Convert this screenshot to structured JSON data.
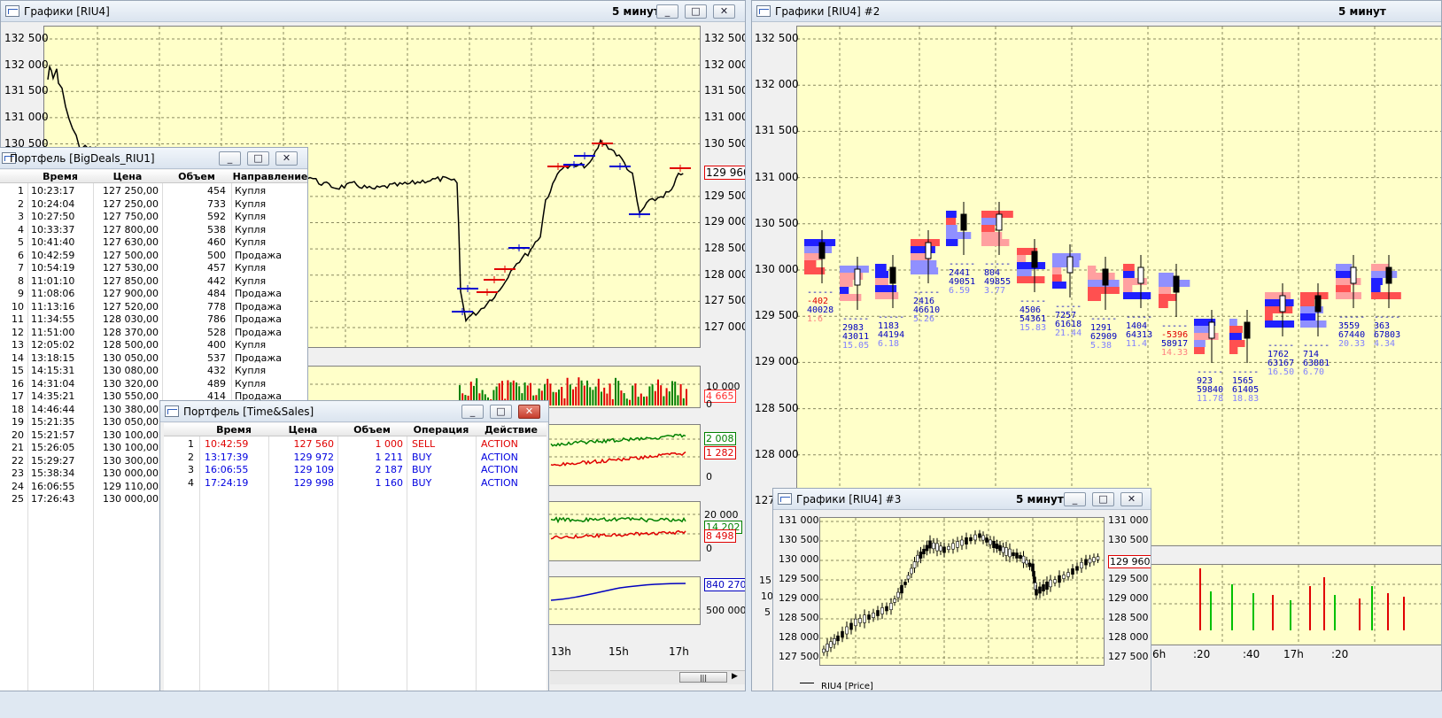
{
  "left_chart": {
    "title": "Графики [RIU4]",
    "interval": "5 минут",
    "price_labels": [
      "132 500",
      "132 000",
      "131 500",
      "131 000",
      "130 500",
      "129 960",
      "129 500",
      "129 000",
      "128 500",
      "128 000",
      "127 500",
      "127 000"
    ],
    "left_price_labels": [
      "132 500",
      "132 000",
      "131 500",
      "131 000",
      "130 500"
    ],
    "volume_labels": {
      "top": "10 000",
      "current": "4 665",
      "zero": "0"
    },
    "ind1_labels": {
      "a": "2 008",
      "b": "1 282",
      "zero": "0"
    },
    "ind2_labels": {
      "top": "20 000",
      "a": "14 202",
      "b": "8 498",
      "zero": "0"
    },
    "ind3_labels": {
      "a": "840 270",
      "b": "500 000"
    },
    "time_labels": [
      "13h",
      "15h",
      "17h"
    ],
    "scroll_label": "|||",
    "colors": {
      "volume_current": "#ff3030",
      "ind1_a": "#008000",
      "ind1_b": "#e00000",
      "ind2_a": "#008000",
      "ind2_b": "#e00000",
      "ind3": "#0000c0"
    }
  },
  "bigdeals": {
    "title": "Портфель [BigDeals_RIU1]",
    "columns": [
      "Время",
      "Цена",
      "Объем",
      "Направление"
    ],
    "rows": [
      [
        "1",
        "10:23:17",
        "127 250,00",
        "454",
        "Купля"
      ],
      [
        "2",
        "10:24:04",
        "127 250,00",
        "733",
        "Купля"
      ],
      [
        "3",
        "10:27:50",
        "127 750,00",
        "592",
        "Купля"
      ],
      [
        "4",
        "10:33:37",
        "127 800,00",
        "538",
        "Купля"
      ],
      [
        "5",
        "10:41:40",
        "127 630,00",
        "460",
        "Купля"
      ],
      [
        "6",
        "10:42:59",
        "127 500,00",
        "500",
        "Продажа"
      ],
      [
        "7",
        "10:54:19",
        "127 530,00",
        "457",
        "Купля"
      ],
      [
        "8",
        "11:01:10",
        "127 850,00",
        "442",
        "Купля"
      ],
      [
        "9",
        "11:08:06",
        "127 900,00",
        "484",
        "Продажа"
      ],
      [
        "10",
        "11:13:16",
        "127 520,00",
        "778",
        "Продажа"
      ],
      [
        "11",
        "11:34:55",
        "128 030,00",
        "786",
        "Продажа"
      ],
      [
        "12",
        "11:51:00",
        "128 370,00",
        "528",
        "Продажа"
      ],
      [
        "13",
        "12:05:02",
        "128 500,00",
        "400",
        "Купля"
      ],
      [
        "14",
        "13:18:15",
        "130 050,00",
        "537",
        "Продажа"
      ],
      [
        "15",
        "14:15:31",
        "130 080,00",
        "432",
        "Купля"
      ],
      [
        "16",
        "14:31:04",
        "130 320,00",
        "489",
        "Купля"
      ],
      [
        "17",
        "14:35:21",
        "130 550,00",
        "414",
        "Продажа"
      ],
      [
        "18",
        "14:46:44",
        "130 380,00",
        "",
        ""
      ],
      [
        "19",
        "15:21:35",
        "130 050,00",
        "",
        ""
      ],
      [
        "20",
        "15:21:57",
        "130 100,00",
        "",
        ""
      ],
      [
        "21",
        "15:26:05",
        "130 100,00",
        "",
        ""
      ],
      [
        "22",
        "15:29:27",
        "130 300,00",
        "",
        ""
      ],
      [
        "23",
        "15:38:34",
        "130 000,00",
        "",
        ""
      ],
      [
        "24",
        "16:06:55",
        "129 110,00",
        "",
        ""
      ],
      [
        "25",
        "17:26:43",
        "130 000,00",
        "",
        ""
      ]
    ]
  },
  "timesales": {
    "title": "Портфель [Time&Sales]",
    "columns": [
      "Время",
      "Цена",
      "Объем",
      "Операция",
      "Действие"
    ],
    "rows": [
      {
        "n": "1",
        "time": "10:42:59",
        "price": "127 560",
        "vol": "1 000",
        "op": "SELL",
        "act": "ACTION",
        "color": "#e00000"
      },
      {
        "n": "2",
        "time": "13:17:39",
        "price": "129 972",
        "vol": "1 211",
        "op": "BUY",
        "act": "ACTION",
        "color": "#0000e0"
      },
      {
        "n": "3",
        "time": "16:06:55",
        "price": "129 109",
        "vol": "2 187",
        "op": "BUY",
        "act": "ACTION",
        "color": "#0000e0"
      },
      {
        "n": "4",
        "time": "17:24:19",
        "price": "129 998",
        "vol": "1 160",
        "op": "BUY",
        "act": "ACTION",
        "color": "#0000e0"
      }
    ]
  },
  "right_chart": {
    "title": "Графики [RIU4] #2",
    "interval": "5 минут",
    "price_labels": [
      "132 500",
      "132 000",
      "131 500",
      "131 000",
      "130 500",
      "130 000",
      "129 500",
      "129 000",
      "128 500",
      "128 000",
      "127"
    ],
    "lower_labels": [
      "15",
      "10",
      "5"
    ],
    "time_labels": [
      "6h",
      ":20",
      ":40",
      "17h",
      ":20"
    ],
    "clusters": [
      {
        "dash": "-----",
        "delta": "-402",
        "vol": "40028",
        "pct": "1.6",
        "dcolor": "#e00000"
      },
      {
        "dash": "-----",
        "delta": "2983",
        "vol": "43011",
        "pct": "15.05",
        "dcolor": "#0000c0"
      },
      {
        "dash": "-----",
        "delta": "1183",
        "vol": "44194",
        "pct": "6.18",
        "dcolor": "#0000c0"
      },
      {
        "dash": "-----",
        "delta": "2416",
        "vol": "46610",
        "pct": "5.26",
        "dcolor": "#0000c0"
      },
      {
        "dash": "-----",
        "delta": "2441",
        "vol": "49051",
        "pct": "6.59",
        "dcolor": "#0000c0"
      },
      {
        "dash": "-----",
        "delta": "804",
        "vol": "49855",
        "pct": "3.77",
        "dcolor": "#0000c0"
      },
      {
        "dash": "-----",
        "delta": "4506",
        "vol": "54361",
        "pct": "15.83",
        "dcolor": "#0000c0"
      },
      {
        "dash": "-----",
        "delta": "7257",
        "vol": "61618",
        "pct": "21.44",
        "dcolor": "#0000c0"
      },
      {
        "dash": "-----",
        "delta": "1291",
        "vol": "62909",
        "pct": "5.38",
        "dcolor": "#0000c0"
      },
      {
        "dash": "-----",
        "delta": "1404",
        "vol": "64313",
        "pct": "11.4",
        "dcolor": "#0000c0"
      },
      {
        "dash": "-----",
        "delta": "-5396",
        "vol": "58917",
        "pct": "14.33",
        "dcolor": "#e00000"
      },
      {
        "dash": "-----",
        "delta": "923",
        "vol": "59840",
        "pct": "11.78",
        "dcolor": "#0000c0"
      },
      {
        "dash": "-----",
        "delta": "1565",
        "vol": "61405",
        "pct": "18.83",
        "dcolor": "#0000c0"
      },
      {
        "dash": "-----",
        "delta": "1762",
        "vol": "63167",
        "pct": "16.50",
        "dcolor": "#0000c0"
      },
      {
        "dash": "-----",
        "delta": "714",
        "vol": "63881",
        "pct": "6.70",
        "dcolor": "#0000c0"
      },
      {
        "dash": "-----",
        "delta": "3559",
        "vol": "67440",
        "pct": "20.33",
        "dcolor": "#0000c0"
      },
      {
        "dash": "-----",
        "delta": "363",
        "vol": "67803",
        "pct": "4.34",
        "dcolor": "#0000c0"
      }
    ]
  },
  "small_chart": {
    "title": "Графики [RIU4] #3",
    "interval": "5 минут",
    "price_labels_left": [
      "131 000",
      "130 500",
      "130 000",
      "129 500",
      "129 000",
      "128 500",
      "128 000",
      "127 500"
    ],
    "price_labels_right": [
      "131 000",
      "130 500",
      "129 960",
      "129 500",
      "129 000",
      "128 500",
      "128 000",
      "127 500"
    ],
    "legend": "RIU4 [Price]"
  },
  "window_buttons": {
    "minimize": "_",
    "maximize": "□",
    "close": "✕"
  }
}
